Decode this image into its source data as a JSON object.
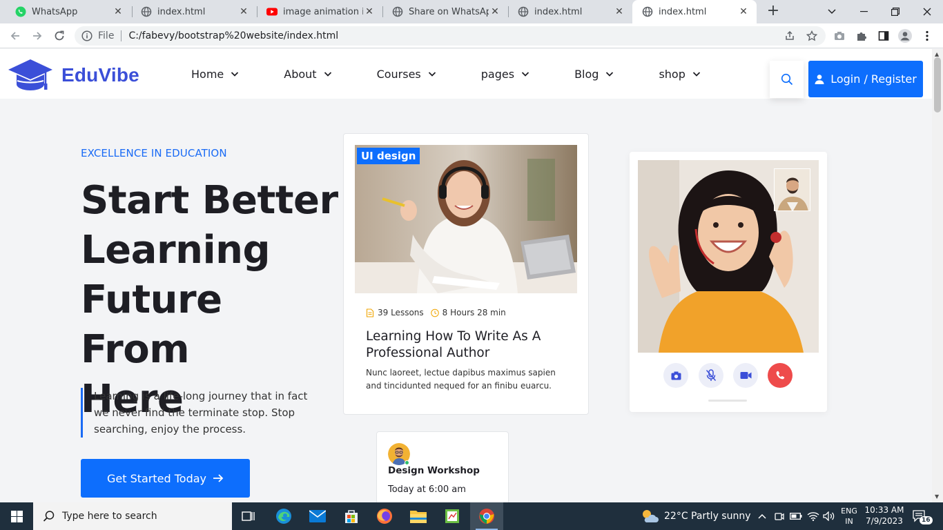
{
  "browser": {
    "tabs": [
      {
        "title": "WhatsApp",
        "icon": "whatsapp-icon"
      },
      {
        "title": "index.html",
        "icon": "globe-icon"
      },
      {
        "title": "image animation in html",
        "icon": "youtube-icon"
      },
      {
        "title": "Share on WhatsApp",
        "icon": "globe-icon"
      },
      {
        "title": "index.html",
        "icon": "globe-icon"
      },
      {
        "title": "index.html",
        "icon": "globe-icon",
        "active": true
      }
    ],
    "address": {
      "scheme_label": "File",
      "url": "C:/fabevy/bootstrap%20website/index.html"
    }
  },
  "site": {
    "brand": "EduVibe",
    "menu": [
      "Home",
      "About",
      "Courses",
      "pages",
      "Blog",
      "shop"
    ],
    "login_label": "Login / Register",
    "accent_color": "#0d6efd"
  },
  "hero": {
    "eyebrow": "EXCELLENCE IN EDUCATION",
    "title_lines": [
      "Start Better",
      "Learning",
      "Future From",
      "Here"
    ],
    "quote": "Learning is a life-long journey that in fact we never find the terminate stop. Stop searching, enjoy the process.",
    "cta_label": "Get Started Today"
  },
  "course_card": {
    "tag": "UI design",
    "lessons": "39 Lessons",
    "duration": "8 Hours 28 min",
    "title": "Learning How To Write As A Professional Author",
    "description": "Nunc laoreet, lectue dapibus maximus sapien and tincidunted nequed for an finibu euarcu."
  },
  "workshop": {
    "title": "Design Workshop",
    "time": "Today at 6:00 am"
  },
  "taskbar": {
    "search_placeholder": "Type here to search",
    "weather": "22°C  Partly sunny",
    "lang_top": "ENG",
    "lang_bottom": "IN",
    "time": "10:33 AM",
    "date": "7/9/2023",
    "notification_count": "16"
  }
}
